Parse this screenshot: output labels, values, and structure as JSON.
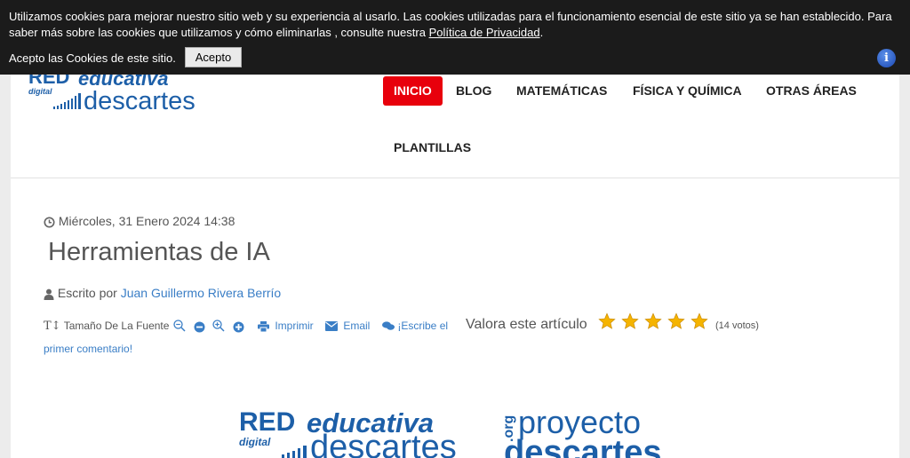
{
  "cookie_banner": {
    "message": "Utilizamos cookies para mejorar nuestro sitio web y su experiencia al usarlo. Las cookies utilizadas para el funcionamiento esencial de este sitio ya se han establecido. Para saber más sobre las cookies que utilizamos y cómo eliminarlas , consulte nuestra",
    "privacy_link": "Política de Privacidad",
    "period": ".",
    "accept_label": "Acepto las Cookies de este sitio.",
    "accept_button": "Acepto",
    "info_icon": "i"
  },
  "logo": {
    "red": "RED",
    "educativa": "educativa",
    "digital": "digital",
    "descartes": "descartes",
    "org": ".org",
    "proyecto": "proyecto",
    "descartes2": "descartes"
  },
  "nav": {
    "items": [
      "INICIO",
      "BLOG",
      "MATEMÁTICAS",
      "FÍSICA Y QUÍMICA",
      "OTRAS ÁREAS",
      "PLANTILLAS"
    ],
    "active_color": "#e8000c"
  },
  "article": {
    "date": "Miércoles, 31 Enero 2024 14:38",
    "title": "Herramientas de IA",
    "written_by": "Escrito por",
    "author": "Juan Guillermo Rivera Berrío"
  },
  "tools": {
    "font_size_label": "Tamaño De La Fuente",
    "print": "Imprimir",
    "email": "Email",
    "comment_start": "¡Escribe el",
    "comment_end": "primer comentario!",
    "rate_label": "Valora este artículo",
    "stars": 5,
    "votes": "(14 votos)"
  },
  "colors": {
    "brand_blue": "#1d5fa8",
    "link_blue": "#3a7ec6",
    "accent_red": "#e8000c"
  }
}
